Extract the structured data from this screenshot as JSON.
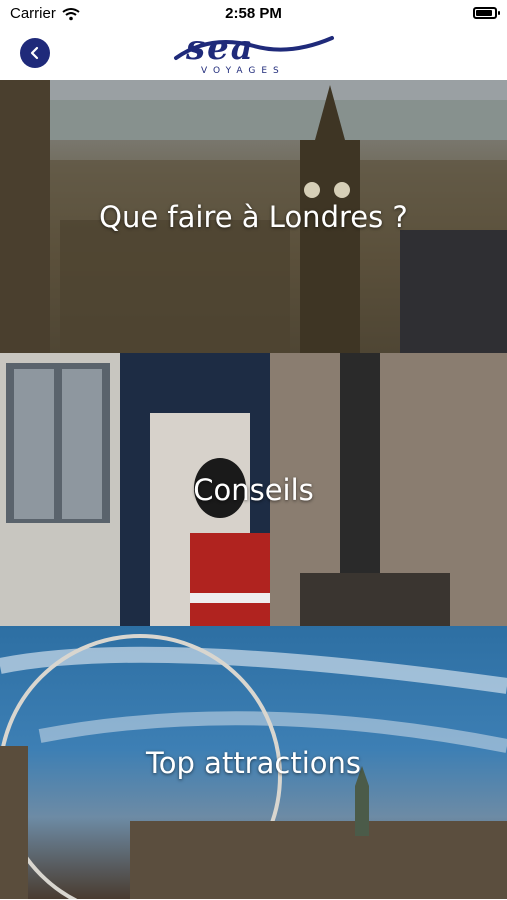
{
  "status_bar": {
    "carrier": "Carrier",
    "time": "2:58 PM",
    "icons": [
      "wifi-icon",
      "battery-icon"
    ]
  },
  "nav": {
    "back_icon": "chevron-left-icon",
    "logo": {
      "word": "sea",
      "sub": "VOYAGES"
    }
  },
  "tiles": [
    {
      "title": "Que faire à Londres ?"
    },
    {
      "title": "Conseils"
    },
    {
      "title": "Top attractions"
    }
  ],
  "colors": {
    "brand": "#1f2a7a"
  }
}
